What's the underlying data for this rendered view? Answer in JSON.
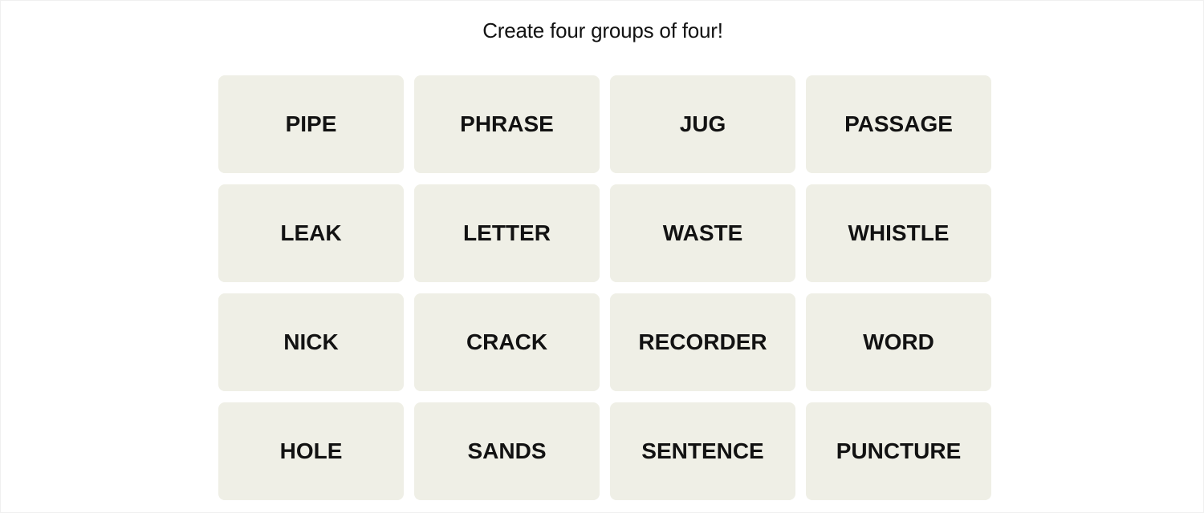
{
  "prompt": "Create four groups of four!",
  "colors": {
    "tile_background": "#efefe6",
    "tile_text": "#121212",
    "page_background": "#ffffff"
  },
  "tiles": [
    {
      "word": "PIPE"
    },
    {
      "word": "PHRASE"
    },
    {
      "word": "JUG"
    },
    {
      "word": "PASSAGE"
    },
    {
      "word": "LEAK"
    },
    {
      "word": "LETTER"
    },
    {
      "word": "WASTE"
    },
    {
      "word": "WHISTLE"
    },
    {
      "word": "NICK"
    },
    {
      "word": "CRACK"
    },
    {
      "word": "RECORDER"
    },
    {
      "word": "WORD"
    },
    {
      "word": "HOLE"
    },
    {
      "word": "SANDS"
    },
    {
      "word": "SENTENCE"
    },
    {
      "word": "PUNCTURE"
    }
  ]
}
